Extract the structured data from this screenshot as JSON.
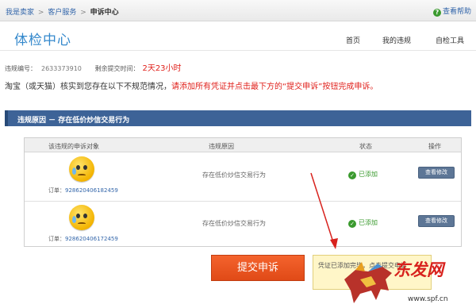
{
  "breadcrumb": {
    "home": "我是卖家",
    "service": "客户服务",
    "current": "申诉中心",
    "sep": ">"
  },
  "help_link": "查看帮助",
  "header": {
    "title": "体检中心",
    "nav": [
      "首页",
      "我的违规",
      "自检工具"
    ]
  },
  "violation_info": {
    "id_label": "违规编号：",
    "id_value": "2633373910",
    "remaining_label": "剩余提交时间：",
    "remaining_value": "2天23小时"
  },
  "notice": {
    "prefix": "淘宝（或天猫）核实到您存在以下不规范情况，",
    "highlight": "请添加所有凭证并点击最下方的“提交申诉”按钮完成申诉。"
  },
  "panel_title": "违规原因 － 存在低价炒信交易行为",
  "table": {
    "headers": [
      "该违规的申诉对象",
      "违规原因",
      "状态",
      "操作"
    ],
    "rows": [
      {
        "order_label": "订单：",
        "order_no": "928620406182459",
        "reason": "存在低价炒信交易行为",
        "status": "已添加",
        "action": "查看修改"
      },
      {
        "order_label": "订单：",
        "order_no": "928620406172459",
        "reason": "存在低价炒信交易行为",
        "status": "已添加",
        "action": "查看修改"
      }
    ]
  },
  "submit_label": "提交申诉",
  "tooltip": "凭证已添加完毕，点击提交申诉",
  "watermark": {
    "brand": "东发网",
    "url": "www.spf.cn"
  },
  "colors": {
    "accent_blue": "#3d6397",
    "alert_red": "#e0201b",
    "submit_orange": "#e8521f",
    "ok_green": "#3a9a2e"
  }
}
